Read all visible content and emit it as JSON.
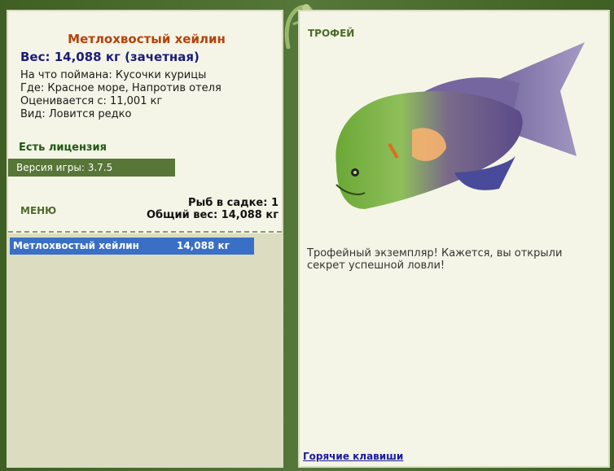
{
  "fish": {
    "title": "Метлохвостый хейлин",
    "weight_line": "Вес: 14,088 кг (зачетная)",
    "caught_on": "На что поймана: Кусочки курицы",
    "location": "Где: Красное море, Напротив отеля",
    "valued_from": "Оценивается с: 11,001 кг",
    "species_note": "Вид: Ловится редко"
  },
  "license": "Есть лицензия",
  "version": "Версия игры: 3.7.5",
  "menu_label": "МЕНЮ",
  "cage": {
    "count_line": "Рыб в садке: 1",
    "total_weight_line": "Общий вес: 14,088 кг"
  },
  "catch_list": [
    {
      "name": "Метлохвостый хейлин",
      "weight": "14,088 кг"
    }
  ],
  "trophy": {
    "header": "ТРОФЕЙ",
    "message": "Трофейный экземпляр! Кажется, вы открыли секрет успешной ловли!"
  },
  "hotkeys_label": "Горячие клавиши",
  "colors": {
    "frame": "#4a6a2c",
    "panel": "#f4f5e6",
    "title": "#b4420a",
    "weight": "#1c1c7a",
    "selection": "#3a6fc6"
  },
  "icons": {
    "decoration": "vine-icon",
    "fish_picture": "broomtail-wrasse-image"
  }
}
